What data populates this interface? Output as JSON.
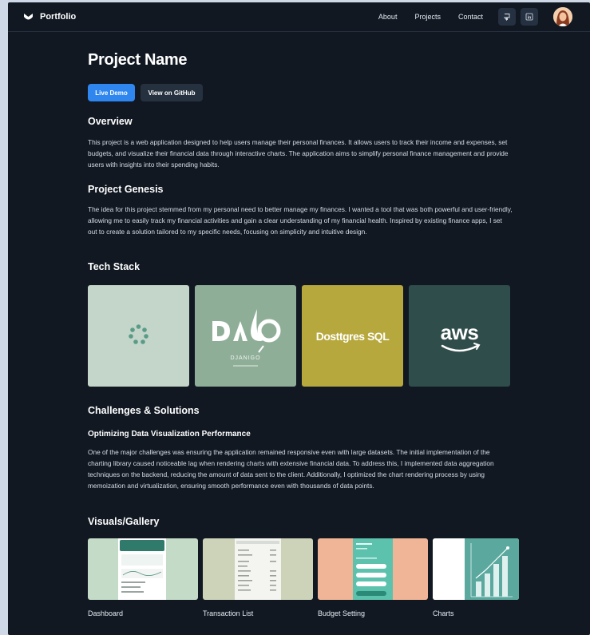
{
  "header": {
    "brand": "Portfolio",
    "nav": [
      "About",
      "Projects",
      "Contact"
    ],
    "icons": [
      "github-icon",
      "linkedin-icon"
    ],
    "avatar": "user-avatar"
  },
  "project": {
    "title": "Project Name",
    "live_demo_label": "Live Demo",
    "github_label": "View on GitHub"
  },
  "overview": {
    "heading": "Overview",
    "text": "This project is a web application designed to help users manage their personal finances. It allows users to track their income and expenses, set budgets, and visualize their financial data through interactive charts. The application aims to simplify personal finance management and provide users with insights into their spending habits."
  },
  "genesis": {
    "heading": "Project Genesis",
    "text": "The idea for this project stemmed from my personal need to better manage my finances. I wanted a tool that was both powerful and user-friendly, allowing me to easily track my financial activities and gain a clear understanding of my financial health. Inspired by existing finance apps, I set out to create a solution tailored to my specific needs, focusing on simplicity and intuitive design."
  },
  "tech_stack": {
    "heading": "Tech Stack",
    "items": [
      {
        "name": "react-logo",
        "bg": "#c4d6c9"
      },
      {
        "name": "django-logo",
        "text": "DJANIGO",
        "bg": "#8fae98"
      },
      {
        "name": "postgresql-logo",
        "text": "Dosttgres SQL",
        "bg": "#b6a83c"
      },
      {
        "name": "aws-logo",
        "text": "aws",
        "bg": "#2f4d4b"
      }
    ]
  },
  "challenges": {
    "heading": "Challenges & Solutions",
    "subheading": "Optimizing Data Visualization Performance",
    "text": "One of the major challenges was ensuring the application remained responsive even with large datasets. The initial implementation of the charting library caused noticeable lag when rendering charts with extensive financial data. To address this, I implemented data aggregation techniques on the backend, reducing the amount of data sent to the client. Additionally, I optimized the chart rendering process by using memoization and virtualization, ensuring smooth performance even with thousands of data points."
  },
  "gallery": {
    "heading": "Visuals/Gallery",
    "items": [
      {
        "label": "Dashboard",
        "bg": "#c4dbc8"
      },
      {
        "label": "Transaction List",
        "bg": "#ccd3b9"
      },
      {
        "label": "Budget Setting",
        "bg": "#f0b497"
      },
      {
        "label": "Charts",
        "bg": "#ffffff"
      }
    ]
  },
  "colors": {
    "background": "#111822",
    "accent": "#2f86ee",
    "secondary_button": "#263140"
  }
}
